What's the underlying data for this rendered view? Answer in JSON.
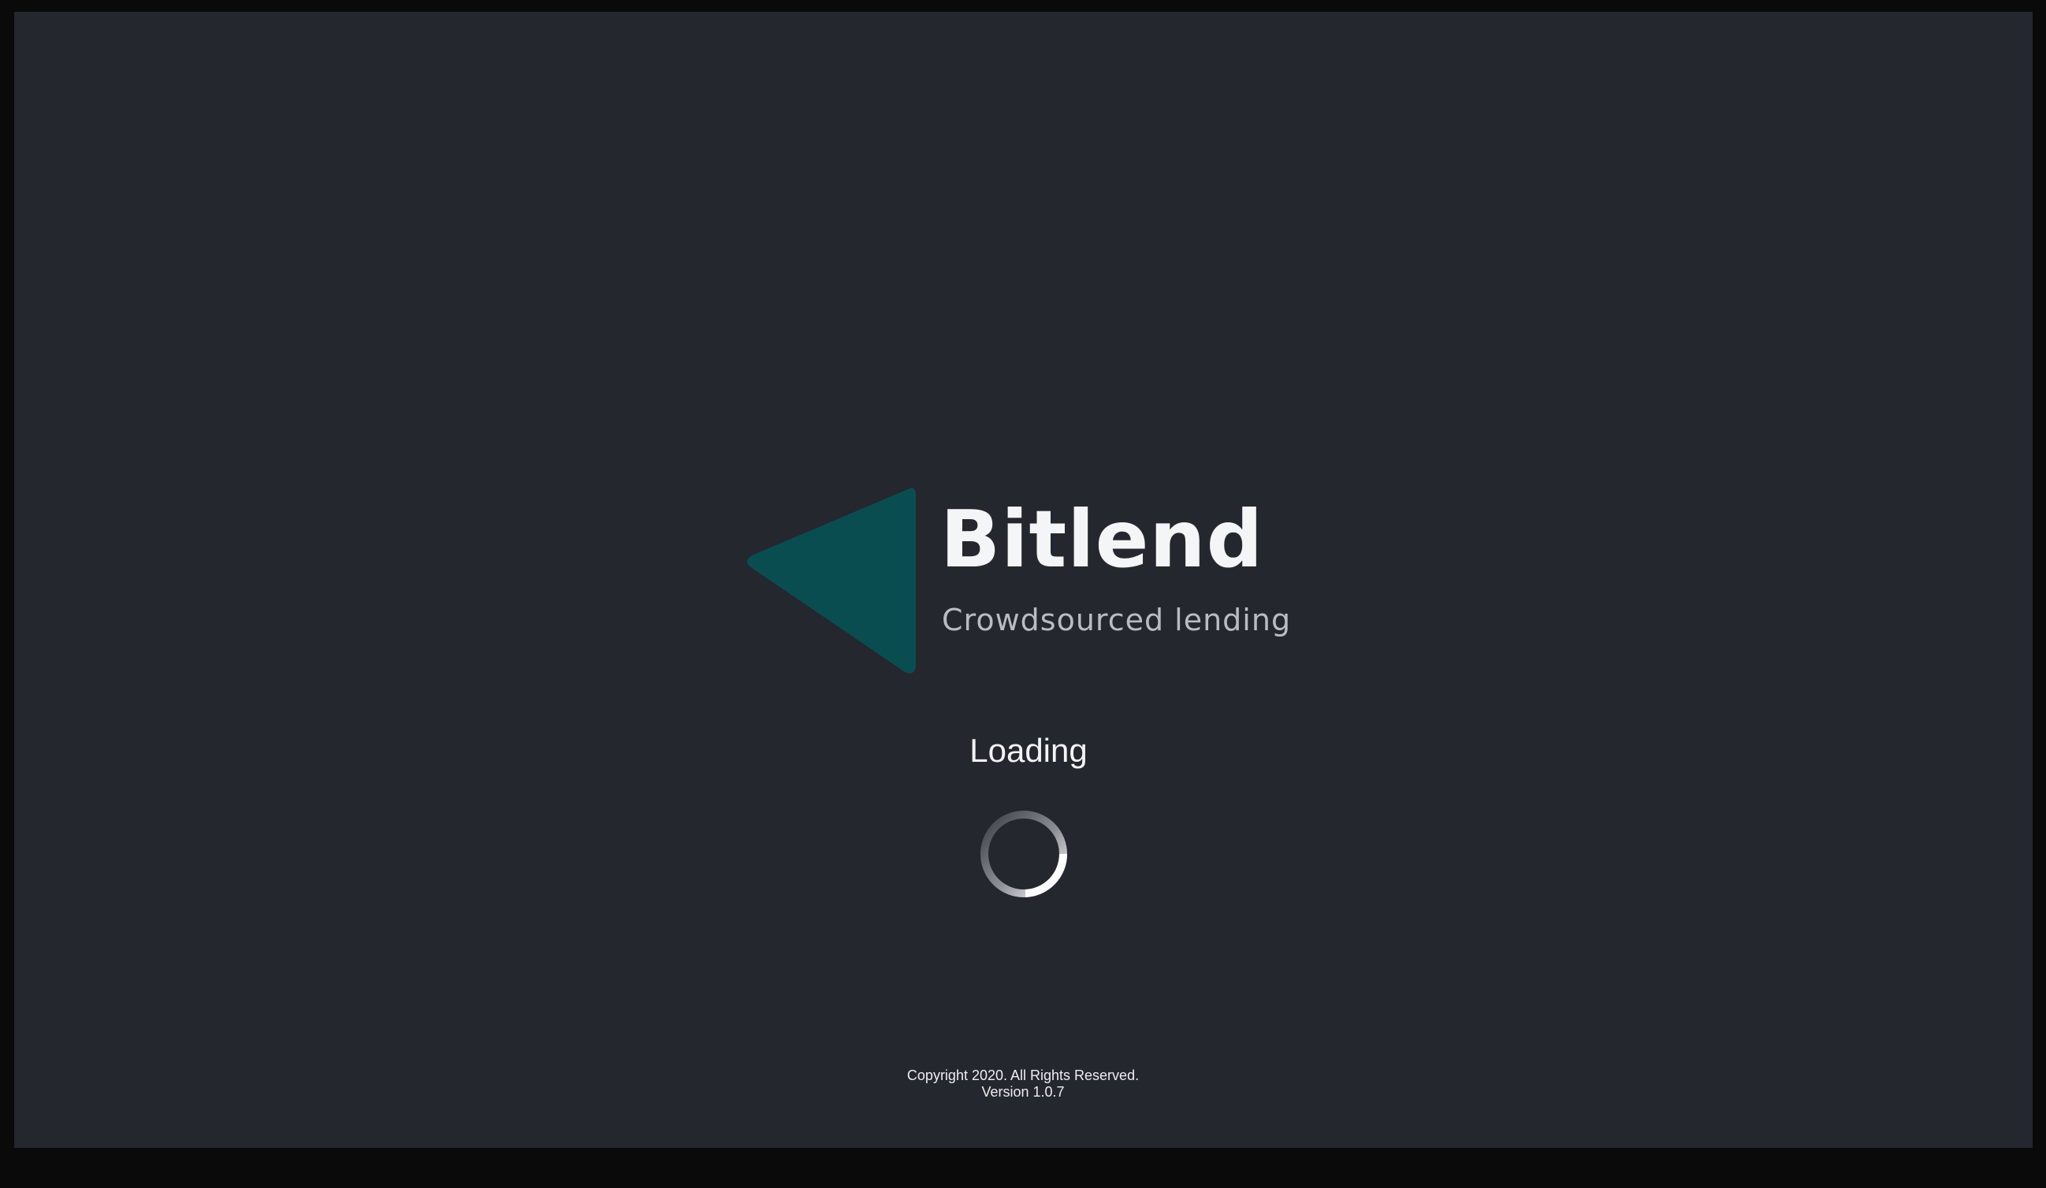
{
  "app": {
    "name": "Bitlend",
    "tagline": "Crowdsourced lending"
  },
  "status": {
    "loading_text": "Loading"
  },
  "footer": {
    "copyright": "Copyright 2020. All Rights Reserved.",
    "version": "Version 1.0.7"
  },
  "icons": {
    "logo": "teal-triangle-logo-icon",
    "spinner": "loading-spinner-icon"
  },
  "colors": {
    "background": "#24272e",
    "logo_teal": "#0a4d50",
    "text_primary": "#f4f5f6",
    "text_secondary": "#b9bcc1"
  }
}
